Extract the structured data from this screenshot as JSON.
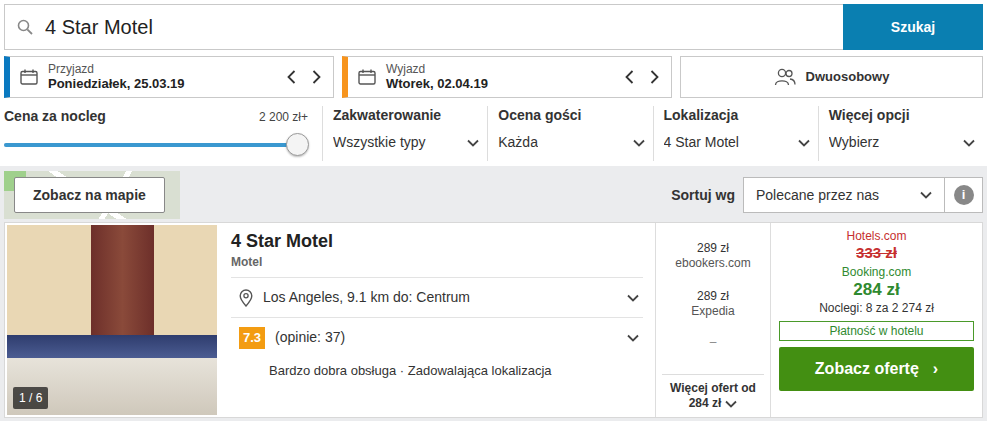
{
  "search": {
    "value": "4 Star Motel",
    "button": "Szukaj"
  },
  "dates": [
    {
      "label": "Przyjazd",
      "value": "Poniedziałek, 25.03.19",
      "color": "#0a79c0"
    },
    {
      "label": "Wyjazd",
      "value": "Wtorek, 02.04.19",
      "color": "#f7941d"
    }
  ],
  "guests": {
    "label": "Dwuosobowy"
  },
  "filters": {
    "price": {
      "label": "Cena za nocleg",
      "reading": "2 200 zł+",
      "level": 1
    },
    "dropdowns": [
      {
        "label": "Zakwaterowanie",
        "value": "Wszystkie typy"
      },
      {
        "label": "Ocena gości",
        "value": "Każda"
      },
      {
        "label": "Lokalizacja",
        "value": "4 Star Motel"
      },
      {
        "label": "Więcej opcji",
        "value": "Wybierz"
      }
    ]
  },
  "toolbar": {
    "map_button": "Zobacz na mapie",
    "sort_label": "Sortuj wg",
    "sort_value": "Polecane przez nas",
    "info": "i"
  },
  "results": [
    {
      "name": "4 Star Motel",
      "type": "Motel",
      "photo_counter": "1 / 6",
      "location": "Los Angeles, 9.1 km do: Centrum",
      "rating": "7.3",
      "reviews": "(opinie: 37)",
      "highlights": "Bardzo dobra obsługa · Zadowalająca lokalizacja",
      "other_offers": [
        {
          "price": "289 zł",
          "site": "ebookers.com"
        },
        {
          "price": "289 zł",
          "site": "Expedia"
        }
      ],
      "empty_offer": "–",
      "more_offers": {
        "label": "Więcej ofert od",
        "price": "284 zł"
      },
      "deal": {
        "old_site": "Hotels.com",
        "old_price": "333 zł",
        "old_price_struck": true,
        "site": "Booking.com",
        "price": "284 zł",
        "nights": "Noclegi: 8 za 2 274 zł",
        "payment": "Płatność w hotelu",
        "button": "Zobacz ofertę",
        "button_arrow": "›"
      }
    }
  ]
}
